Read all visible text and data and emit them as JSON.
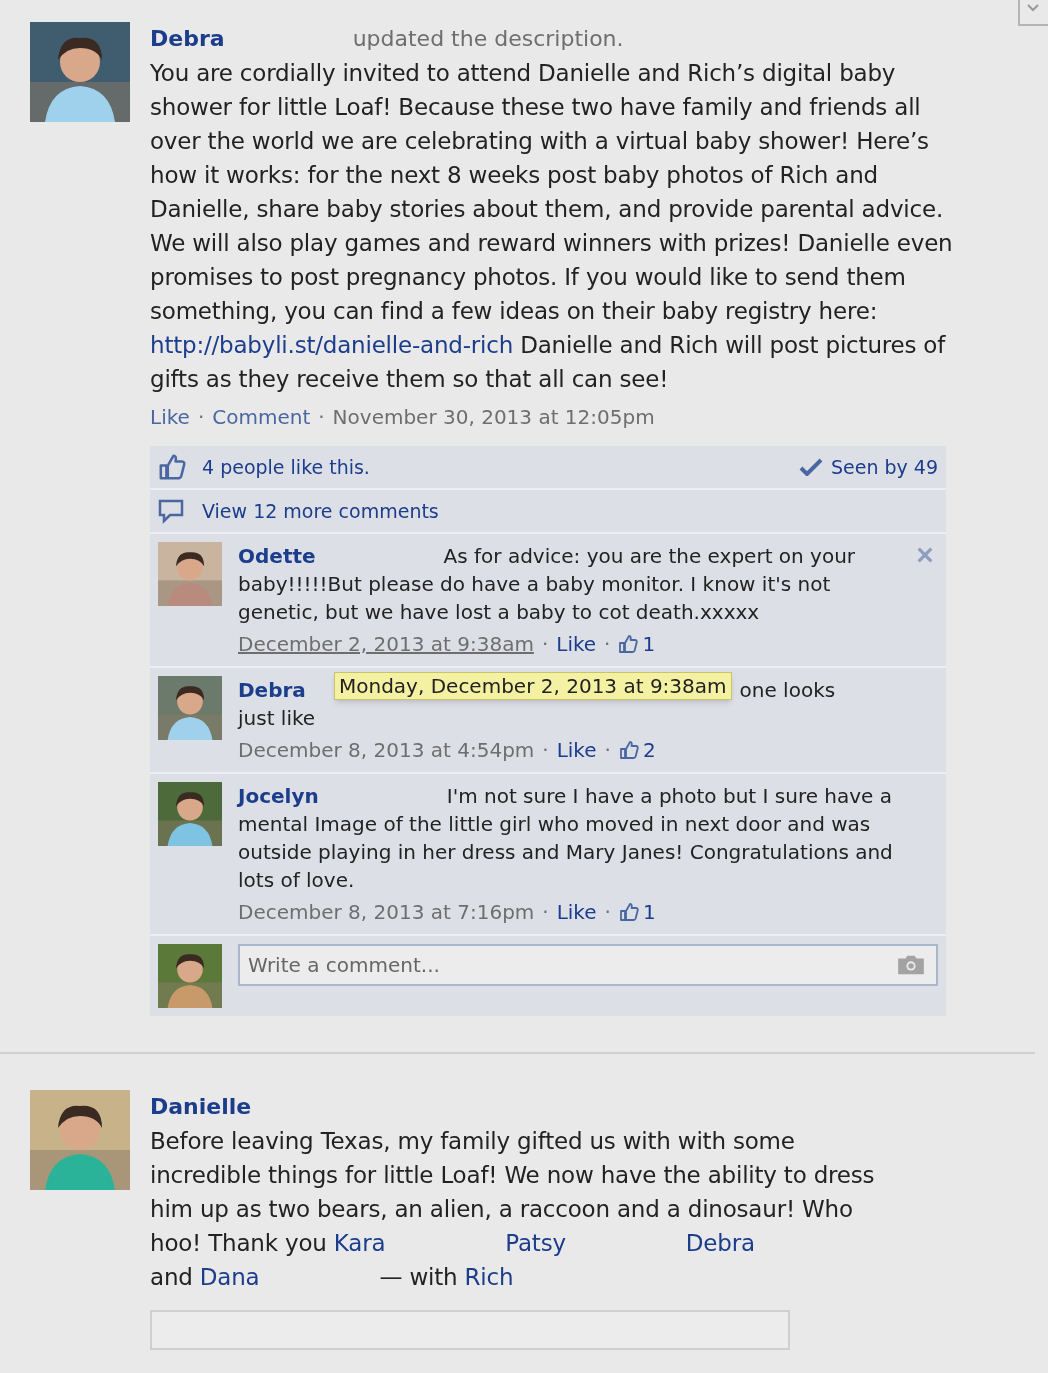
{
  "posts": [
    {
      "author": "Debra",
      "action": "updated the description.",
      "body": [
        {
          "kind": "text",
          "text": "You are cordially invited to attend Danielle and Rich’s digital baby shower for little Loaf! Because these two have family and friends all over the world we are celebrating with a virtual baby shower! Here’s how it works: for the next 8 weeks post baby photos of Rich and Danielle, share baby stories about them, and provide parental advice. We will also play games and reward winners with prizes! Danielle even promises to post pregnancy photos. If you would like to send them something, you can find a few ideas on their baby registry here: "
        },
        {
          "kind": "link",
          "text": "http://babyli.st/danielle-and-rich"
        },
        {
          "kind": "text",
          "text": " Danielle and Rich will post pictures of gifts as they receive them so that all can see!"
        }
      ],
      "actions": [
        {
          "label": "Like",
          "separator": "·"
        },
        {
          "label": "Comment",
          "separator": "·"
        }
      ],
      "time": "November 30, 2013 at 12:05pm",
      "likes": "4 people like this.",
      "seen": "Seen by 49",
      "more_comments": "View 12 more comments",
      "comments": [
        {
          "author": "Odette",
          "text": "As for advice: you are the expert on your baby!!!!!But please do have a baby monitor. I know it's not genetic, but we have lost a baby to cot death.xxxxx",
          "time": "December 2, 2013 at 9:38am",
          "hovered": true,
          "sep_1": "·",
          "like": "Like",
          "sep_2": "·",
          "like_count": "1",
          "delete": true
        },
        {
          "author": "Debra",
          "text": "one looks",
          "text_2": "just like",
          "tooltip": "Monday, December 2, 2013 at 9:38am",
          "time": "December 8, 2013 at 4:54pm",
          "hovered": false,
          "sep_1": "·",
          "like": "Like",
          "sep_2": "·",
          "like_count": "2",
          "delete": false
        },
        {
          "author": "Jocelyn",
          "text": "I'm not sure I have a photo but I sure have a mental Image of the little girl who moved in next door and was outside playing in her dress and Mary Janes! Congratulations and lots of love.",
          "time": "December 8, 2013 at 7:16pm",
          "hovered": false,
          "sep_1": "·",
          "like": "Like",
          "sep_2": "·",
          "like_count": "1",
          "delete": false
        }
      ],
      "composer": {
        "placeholder": "Write a comment..."
      }
    },
    {
      "author": "Danielle",
      "body": [
        {
          "kind": "text",
          "text": "Before leaving Texas, my family gifted us with with some"
        },
        {
          "kind": "break"
        },
        {
          "kind": "text",
          "text": "incredible things for little Loaf! We now have the ability to dress"
        },
        {
          "kind": "break"
        },
        {
          "kind": "text",
          "text": "him up as two bears, an alien, a raccoon and a dinosaur! Who"
        },
        {
          "kind": "break"
        },
        {
          "kind": "text",
          "text": "hoo! Thank you "
        },
        {
          "kind": "link",
          "text": "Kara"
        },
        {
          "kind": "gap"
        },
        {
          "kind": "link",
          "text": "Patsy"
        },
        {
          "kind": "gap"
        },
        {
          "kind": "link",
          "text": "Debra"
        },
        {
          "kind": "break"
        },
        {
          "kind": "text",
          "text": "and "
        },
        {
          "kind": "link",
          "text": "Dana"
        },
        {
          "kind": "gap"
        },
        {
          "kind": "text",
          "text": "— with "
        },
        {
          "kind": "link",
          "text": "Rich"
        }
      ]
    }
  ]
}
